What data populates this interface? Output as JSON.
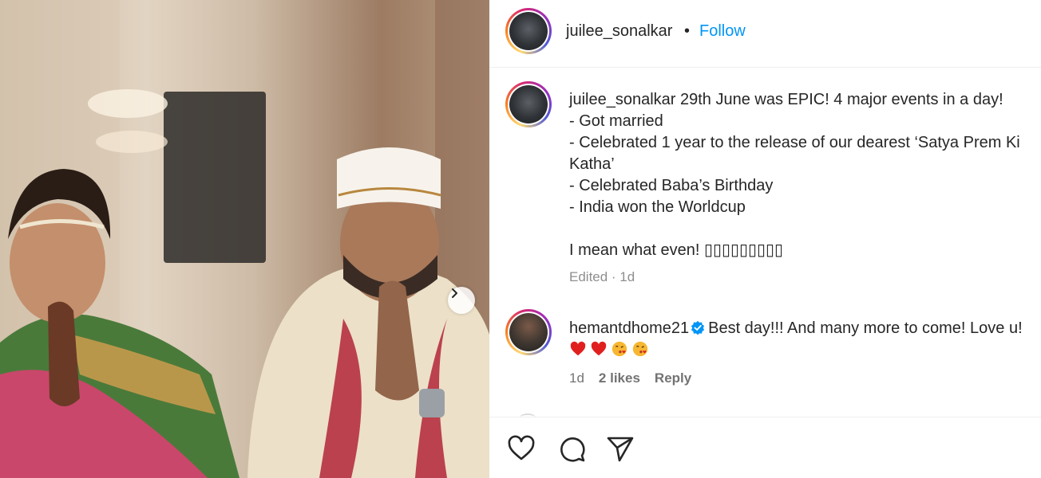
{
  "post": {
    "photo": {
      "alt_subject": "wedding-couple-photo",
      "next_arrow": "chevron-right-icon"
    },
    "author": {
      "username": "juilee_sonalkar",
      "separator": "•",
      "follow_label": "Follow"
    },
    "caption": {
      "username": "juilee_sonalkar",
      "lines": [
        "29th June was EPIC! 4 major events in a day!",
        "- Got married",
        "- Celebrated 1 year to the release of our dearest ‘Satya Prem Ki Katha’",
        "- Celebrated Baba’s Birthday",
        "- India won the Worldcup",
        "",
        "I mean what even! ▯▯▯▯▯▯▯▯▯"
      ],
      "meta": "Edited · 1d"
    },
    "comments": [
      {
        "username": "hemantdhome21",
        "verified": true,
        "text": "Best day!!! And many more to come! Love u!",
        "emojis": [
          "heart-emoji",
          "heart-emoji",
          "kissing-face-emoji",
          "kissing-face-emoji"
        ],
        "time": "1d",
        "likes": "2 likes",
        "reply_label": "Reply"
      }
    ],
    "actions": {
      "like": "heart-icon",
      "comment": "comment-bubble-icon",
      "share": "send-icon"
    },
    "colors": {
      "follow": "#0095f6",
      "meta": "#8e8e8e",
      "verified": "#0095f6",
      "heart": "#e0201f",
      "text": "#262626"
    }
  }
}
